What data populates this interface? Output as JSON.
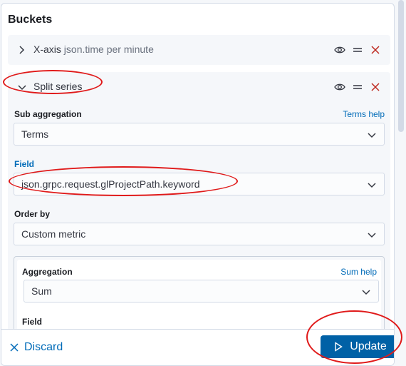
{
  "buckets": {
    "title": "Buckets"
  },
  "xaxis_row": {
    "label": "X-axis",
    "detail": "json.time per minute"
  },
  "split_row": {
    "label": "Split series"
  },
  "sub_aggregation": {
    "label": "Sub aggregation",
    "help": "Terms help",
    "value": "Terms"
  },
  "field": {
    "label": "Field",
    "value": "json.grpc.request.glProjectPath.keyword"
  },
  "order_by": {
    "label": "Order by",
    "value": "Custom metric"
  },
  "inner": {
    "aggregation_label": "Aggregation",
    "aggregation_help": "Sum help",
    "aggregation_value": "Sum",
    "field_label": "Field"
  },
  "footer": {
    "discard_label": "Discard",
    "update_label": "Update"
  },
  "icons": {
    "eye": "eye-icon",
    "drag": "drag-handle-icon",
    "remove": "close-icon"
  },
  "colors": {
    "accent": "#006bb8",
    "primary_button": "#0061a6",
    "remove": "#bd271e",
    "annotation": "#e01a1a"
  }
}
